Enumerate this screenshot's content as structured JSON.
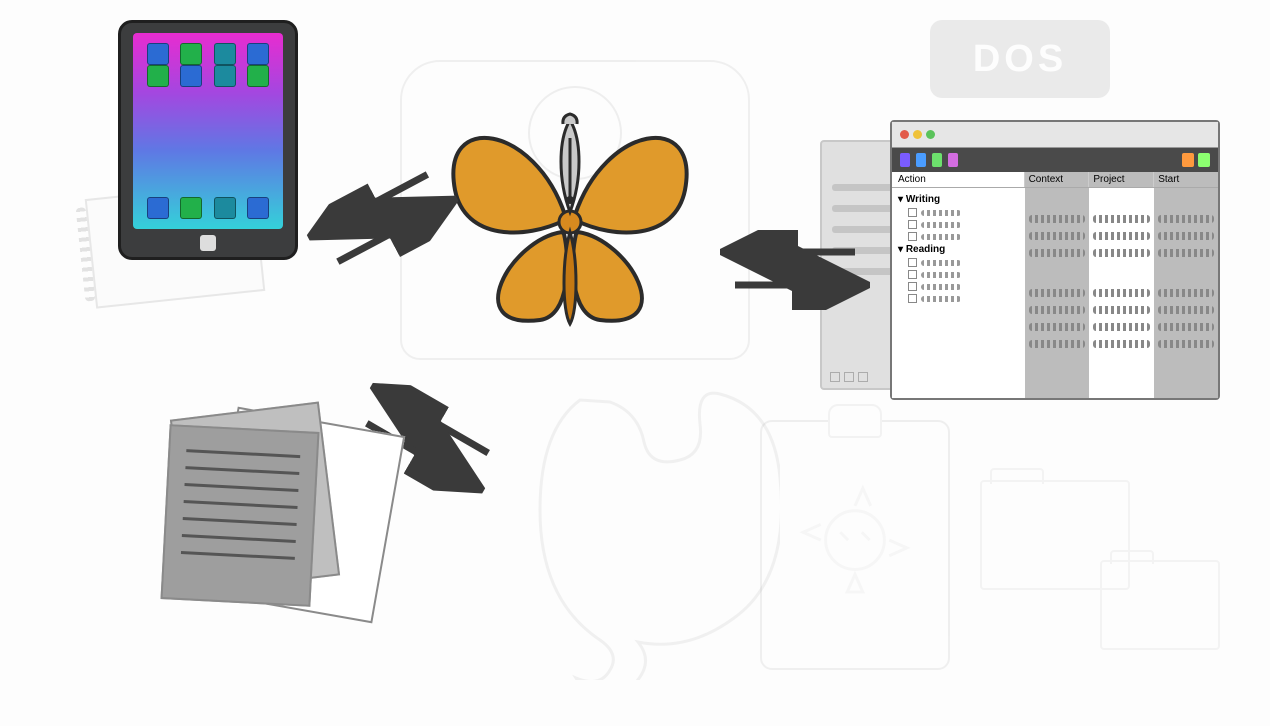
{
  "dos_label": "DOS",
  "task_window": {
    "columns": [
      "Action",
      "Context",
      "Project",
      "Start"
    ],
    "groups": [
      {
        "name": "Writing",
        "item_count": 3
      },
      {
        "name": "Reading",
        "item_count": 4
      }
    ]
  },
  "elements": {
    "center": "butterfly-logo",
    "top_left": "tablet-device",
    "bottom_left": "documents-stack",
    "right": "task-manager-window",
    "faded": [
      "stopwatch/monitor",
      "elephant (evernote)",
      "clipboard-with-ribbon",
      "folders",
      "DOS badge"
    ]
  },
  "arrows": [
    {
      "between": [
        "butterfly",
        "tablet"
      ],
      "bidirectional": true
    },
    {
      "between": [
        "butterfly",
        "task-window"
      ],
      "bidirectional": true
    },
    {
      "between": [
        "butterfly",
        "documents"
      ],
      "bidirectional": true
    }
  ]
}
